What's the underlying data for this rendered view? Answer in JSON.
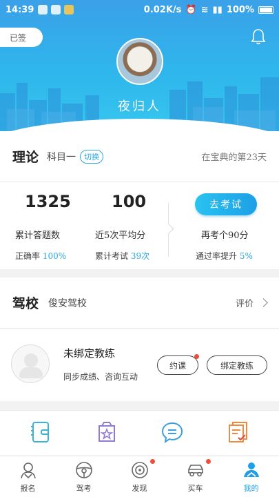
{
  "status_bar": {
    "time": "14:39",
    "network_speed": "0.02K/s",
    "battery": "100%"
  },
  "header": {
    "signed_label": "已签",
    "username": "夜归人",
    "colors": {
      "top": "#3aa0e8",
      "bottom": "#36c6ee"
    }
  },
  "theory": {
    "title": "理论",
    "subject": "科目一",
    "switch_label": "切换",
    "days_text": "在宝典的第23天",
    "stats": [
      {
        "value": "1325",
        "label": "累计答题数",
        "sub_label": "正确率",
        "sub_value": "100%"
      },
      {
        "value": "100",
        "label": "近5次平均分",
        "sub_label": "累计考试",
        "sub_value": "39次"
      }
    ],
    "exam_button": "去考试",
    "exam_hint": "再考个90分",
    "pass_rate_label": "通过率提升",
    "pass_rate_value": "5%"
  },
  "school": {
    "title": "驾校",
    "name": "俊安驾校",
    "rate_label": "评价"
  },
  "coach": {
    "title": "未绑定教练",
    "subtitle": "同步成绩、咨询互动",
    "appoint_label": "约课",
    "bind_label": "绑定教练"
  },
  "tools": [
    "notebook-icon",
    "favorites-icon",
    "message-icon",
    "records-icon"
  ],
  "nav": {
    "items": [
      {
        "label": "报名",
        "icon": "signup-icon",
        "active": false,
        "dot": false
      },
      {
        "label": "驾考",
        "icon": "steering-wheel-icon",
        "active": false,
        "dot": false
      },
      {
        "label": "发现",
        "icon": "discover-icon",
        "active": false,
        "dot": true
      },
      {
        "label": "买车",
        "icon": "car-icon",
        "active": false,
        "dot": true
      },
      {
        "label": "我的",
        "icon": "profile-icon",
        "active": true,
        "dot": false
      }
    ]
  },
  "accent_color": "#29a7e1"
}
